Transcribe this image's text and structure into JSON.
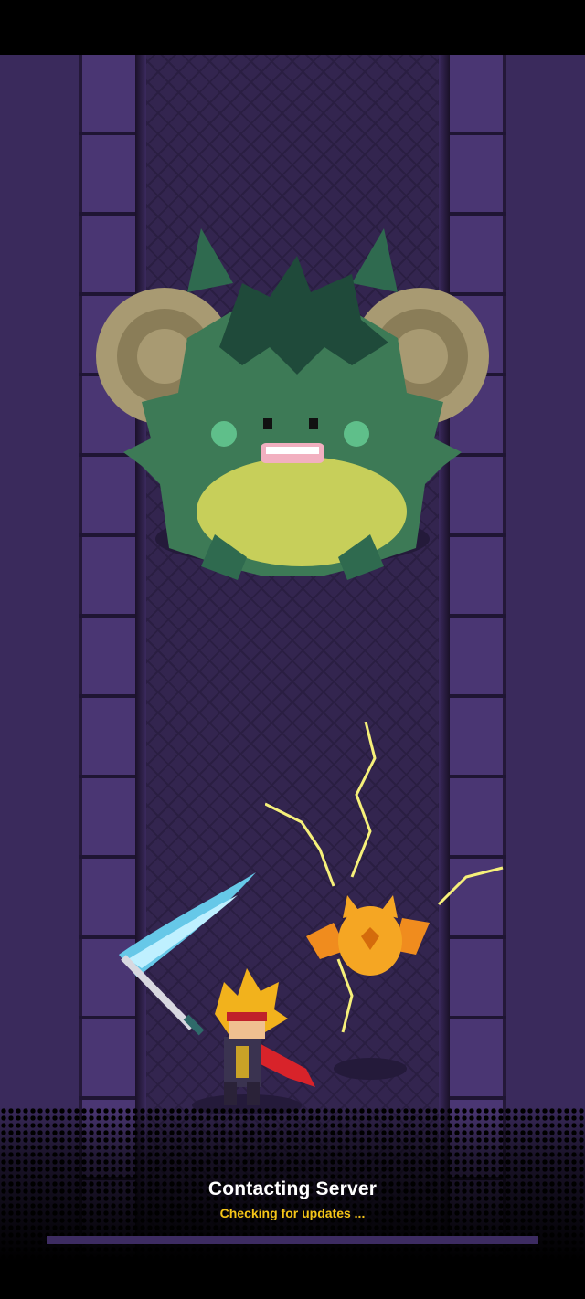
{
  "loading": {
    "title": "Contacting Server",
    "subtitle": "Checking for updates ...",
    "progress": 0
  },
  "colors": {
    "title_text": "#ffffff",
    "subtitle_text": "#f5c518",
    "progress_track": "#3d2c62",
    "wall": "#3a2a5c",
    "floor": "#33254f"
  },
  "scene": {
    "characters": [
      "ram-horned-monster-boss",
      "blonde-swordsman-hero",
      "electric-bird-companion"
    ]
  }
}
